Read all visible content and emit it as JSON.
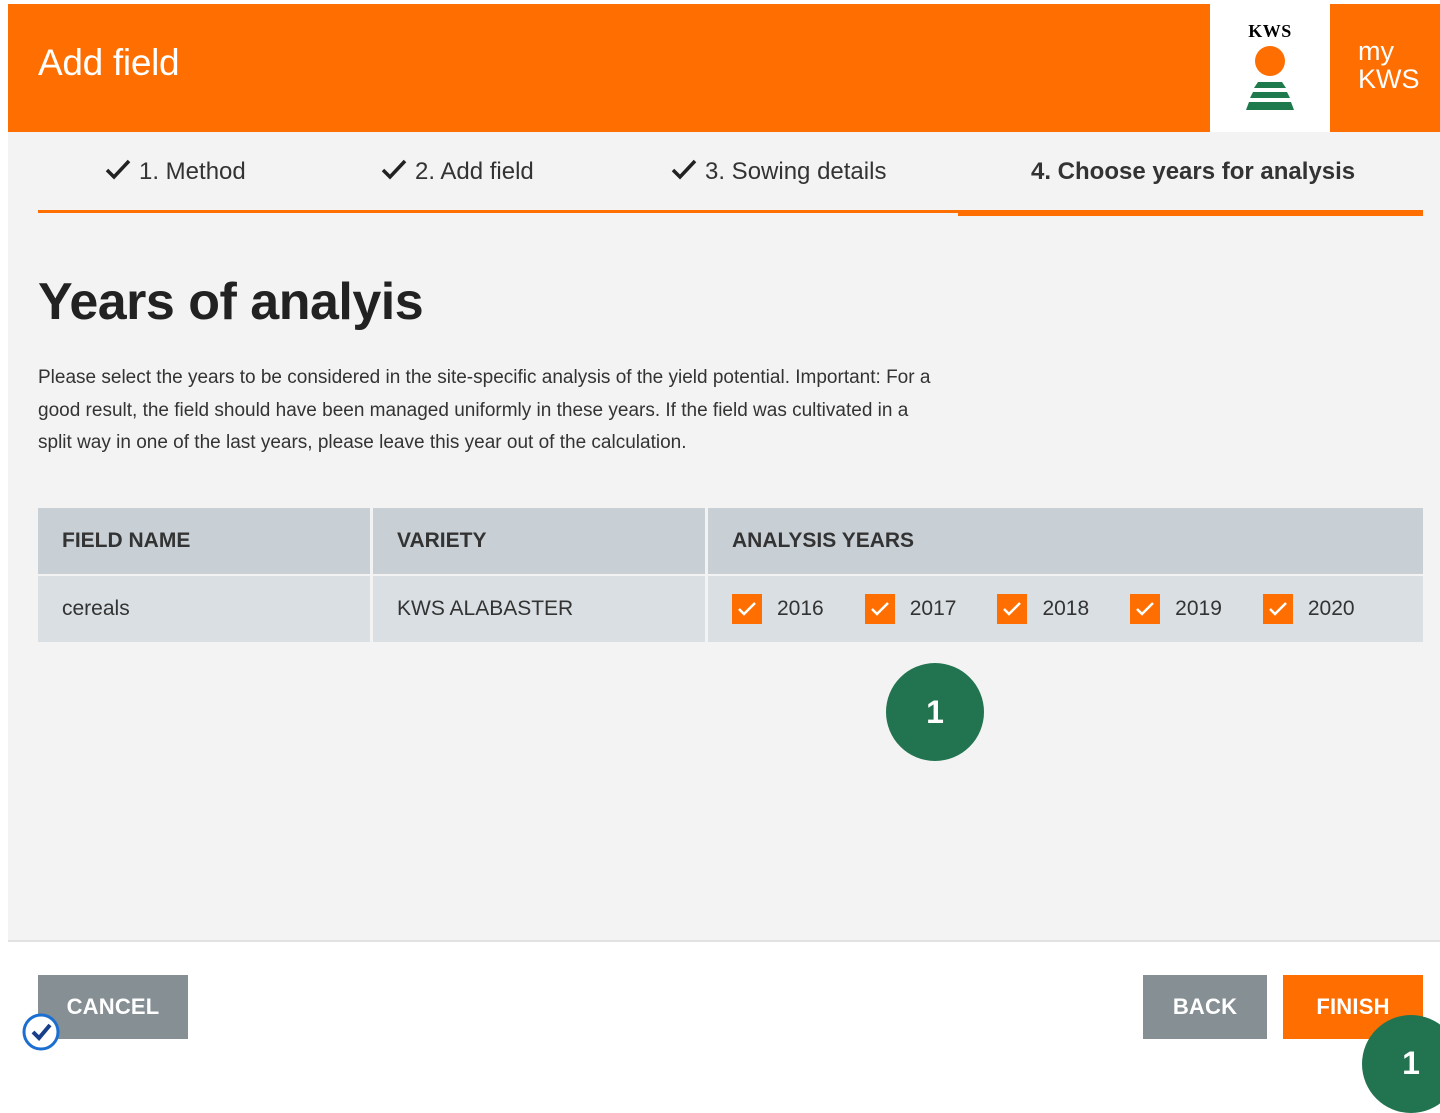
{
  "header": {
    "title": "Add field",
    "logo_text": "KWS",
    "mykws_line1": "my",
    "mykws_line2": "KWS",
    "color": "#ff6e00"
  },
  "steps": [
    {
      "label": "1. Method",
      "done": true,
      "icon": "checkmark-icon"
    },
    {
      "label": "2. Add field",
      "done": true,
      "icon": "checkmark-icon"
    },
    {
      "label": "3. Sowing details",
      "done": true,
      "icon": "checkmark-icon"
    },
    {
      "label": "4. Choose years for analysis",
      "active": true
    }
  ],
  "main": {
    "title": "Years of analyis",
    "description": "Please select the years to be considered in the site-specific analysis of the yield potential. Important: For a good result, the field should have been managed uniformly in these years. If the field was cultivated in a split way in one of the last years, please leave this year out of the calculation."
  },
  "table": {
    "headers": [
      "FIELD NAME",
      "VARIETY",
      "ANALYSIS YEARS"
    ],
    "row": {
      "field_name": "cereals",
      "variety": "KWS ALABASTER",
      "years": [
        {
          "label": "2016",
          "checked": true
        },
        {
          "label": "2017",
          "checked": true
        },
        {
          "label": "2018",
          "checked": true
        },
        {
          "label": "2019",
          "checked": true
        },
        {
          "label": "2020",
          "checked": true
        }
      ]
    }
  },
  "badge": {
    "label": "1",
    "color": "#21744f"
  },
  "corner_badge": {
    "label": "1"
  },
  "footer": {
    "cancel_label": "CANCEL",
    "back_label": "BACK",
    "finish_label": "FINISH"
  },
  "colors": {
    "accent": "#ff6e00",
    "secondary_button": "#858f94",
    "table_header": "#c8d0d6",
    "table_row": "#d9dfe3"
  }
}
